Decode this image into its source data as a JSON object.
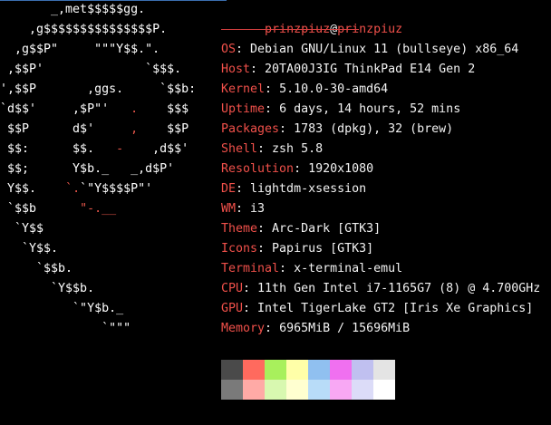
{
  "logo": {
    "lines": [
      {
        "t": "       _,met$$$$$gg.",
        "c": "w"
      },
      {
        "t": "    ,g$$$$$$$$$$$$$$$P.",
        "c": "w"
      },
      {
        "t": "  ,g$$P\"     \"\"\"Y$$.\".",
        "c": "w"
      },
      {
        "t": " ,$$P'              `$$$.",
        "c": "w"
      },
      {
        "t": "',$$P       ,ggs.     `$$b:",
        "c": "w"
      },
      {
        "t": "`d$$'     ,$P\"'   ",
        "c": "w",
        "r": ".",
        "t2": "    $$$"
      },
      {
        "t": " $$P      d$'     ",
        "c": "w",
        "r": ",",
        "t2": "    $$P"
      },
      {
        "t": " $$:      $$.   ",
        "c": "w",
        "r": "-",
        "t2": "    ,d$$'"
      },
      {
        "t": " $$;      Y$b._   _,d$P'",
        "c": "w"
      },
      {
        "t": " Y$$.    ",
        "c": "w",
        "r": "`.",
        "t2": "`\"Y$$$$P\"'"
      },
      {
        "t": " `$$b      ",
        "c": "w",
        "r": "\"-.__",
        "t2": ""
      },
      {
        "t": "  `Y$$",
        "c": "w"
      },
      {
        "t": "   `Y$$.",
        "c": "w"
      },
      {
        "t": "     `$$b.",
        "c": "w"
      },
      {
        "t": "       `Y$$b.",
        "c": "w"
      },
      {
        "t": "          `\"Y$b._",
        "c": "w"
      },
      {
        "t": "              `\"\"\"",
        "c": "w"
      }
    ]
  },
  "header": {
    "user": "prinzpiuz",
    "at": "@",
    "host": "prinzpiuz",
    "separator": "-------------------"
  },
  "info": [
    {
      "key": "OS",
      "value": "Debian GNU/Linux 11 (bullseye) x86_64"
    },
    {
      "key": "Host",
      "value": "20TA00J3IG ThinkPad E14 Gen 2"
    },
    {
      "key": "Kernel",
      "value": "5.10.0-30-amd64"
    },
    {
      "key": "Uptime",
      "value": "6 days, 14 hours, 52 mins"
    },
    {
      "key": "Packages",
      "value": "1783 (dpkg), 32 (brew)"
    },
    {
      "key": "Shell",
      "value": "zsh 5.8"
    },
    {
      "key": "Resolution",
      "value": "1920x1080"
    },
    {
      "key": "DE",
      "value": "lightdm-xsession"
    },
    {
      "key": "WM",
      "value": "i3"
    },
    {
      "key": "Theme",
      "value": "Arc-Dark [GTK3]"
    },
    {
      "key": "Icons",
      "value": "Papirus [GTK3]"
    },
    {
      "key": "Terminal",
      "value": "x-terminal-emul"
    },
    {
      "key": "CPU",
      "value": "11th Gen Intel i7-1165G7 (8) @ 4.700GHz"
    },
    {
      "key": "GPU",
      "value": "Intel TigerLake GT2 [Iris Xe Graphics]"
    },
    {
      "key": "Memory",
      "value": "6965MiB / 15696MiB"
    }
  ],
  "palette": {
    "normal": [
      "#4a4a4a",
      "#ff6a5e",
      "#a8f05c",
      "#ffffa8",
      "#90c0f0",
      "#f070f0",
      "#c0c0f0",
      "#e4e4e4"
    ],
    "bright": [
      "#7a7a7a",
      "#ffaaa6",
      "#d8f8b0",
      "#ffffd0",
      "#b8dcf8",
      "#f8a8f4",
      "#dcdcf8",
      "#ffffff"
    ]
  },
  "colors": {
    "background": "#000000",
    "accent": "#f0504a",
    "text": "#f2f2f2"
  }
}
